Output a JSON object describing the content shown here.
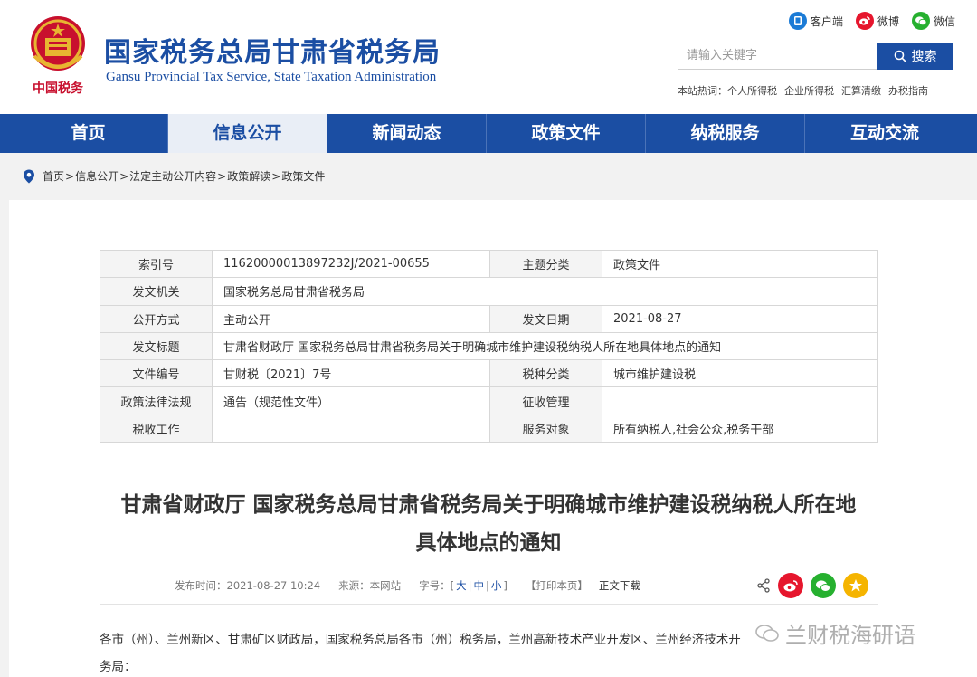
{
  "header": {
    "site_title": "国家税务总局甘肃省税务局",
    "site_subtitle": "Gansu Provincial Tax Service, State Taxation Administration",
    "logo_text": "中国税务",
    "quick_links": [
      {
        "label": "客户端",
        "icon": "phone-app-icon",
        "color": "#1b7bd6"
      },
      {
        "label": "微博",
        "icon": "weibo-icon",
        "color": "#e6162d"
      },
      {
        "label": "微信",
        "icon": "wechat-icon",
        "color": "#26b02f"
      }
    ],
    "search": {
      "placeholder": "请输入关键字",
      "button_label": "搜索"
    },
    "hot_words_label": "本站热词：",
    "hot_words": [
      "个人所得税",
      "企业所得税",
      "汇算清缴",
      "办税指南"
    ]
  },
  "nav": {
    "items": [
      "首页",
      "信息公开",
      "新闻动态",
      "政策文件",
      "纳税服务",
      "互动交流"
    ],
    "active_index": 1
  },
  "breadcrumb": [
    "首页",
    "信息公开",
    "法定主动公开内容",
    "政策解读",
    "政策文件"
  ],
  "meta": {
    "rows": [
      {
        "l1": "索引号",
        "v1": "11620000013897232J/2021-00655",
        "l2": "主题分类",
        "v2": "政策文件"
      },
      {
        "l1": "发文机关",
        "v1": "国家税务总局甘肃省税务局"
      },
      {
        "l1": "公开方式",
        "v1": "主动公开",
        "l2": "发文日期",
        "v2": "2021-08-27"
      },
      {
        "l1": "发文标题",
        "v1": "甘肃省财政厅 国家税务总局甘肃省税务局关于明确城市维护建设税纳税人所在地具体地点的通知"
      },
      {
        "l1": "文件编号",
        "v1": "甘财税〔2021〕7号",
        "l2": "税种分类",
        "v2": "城市维护建设税"
      },
      {
        "l1": "政策法律法规",
        "v1": "通告（规范性文件）",
        "l2": "征收管理",
        "v2": ""
      },
      {
        "l1": "税收工作",
        "v1": "",
        "l2": "服务对象",
        "v2": "所有纳税人,社会公众,税务干部"
      }
    ]
  },
  "article": {
    "title_line1": "甘肃省财政厅 国家税务总局甘肃省税务局关于明确城市维护建设税纳税人所在地",
    "title_line2": "具体地点的通知",
    "publish_time": "发布时间：2021-08-27 10:24",
    "source": "来源：本网站",
    "font_size_label": "字号：",
    "font_sizes": [
      "大",
      "中",
      "小"
    ],
    "print_label": "【打印本页】",
    "download_label": "正文下载",
    "body_line1": "各市（州）、兰州新区、甘肃矿区财政局，国家税务总局各市（州）税务局，兰州高新技术产业开发区、兰州经济技术开",
    "body_line2": "务局："
  },
  "watermark": "兰财税海研语",
  "colors": {
    "brand_blue": "#1b4ea3",
    "weibo_red": "#e6162d",
    "wechat_green": "#26b02f",
    "star_yellow": "#f5b400"
  }
}
